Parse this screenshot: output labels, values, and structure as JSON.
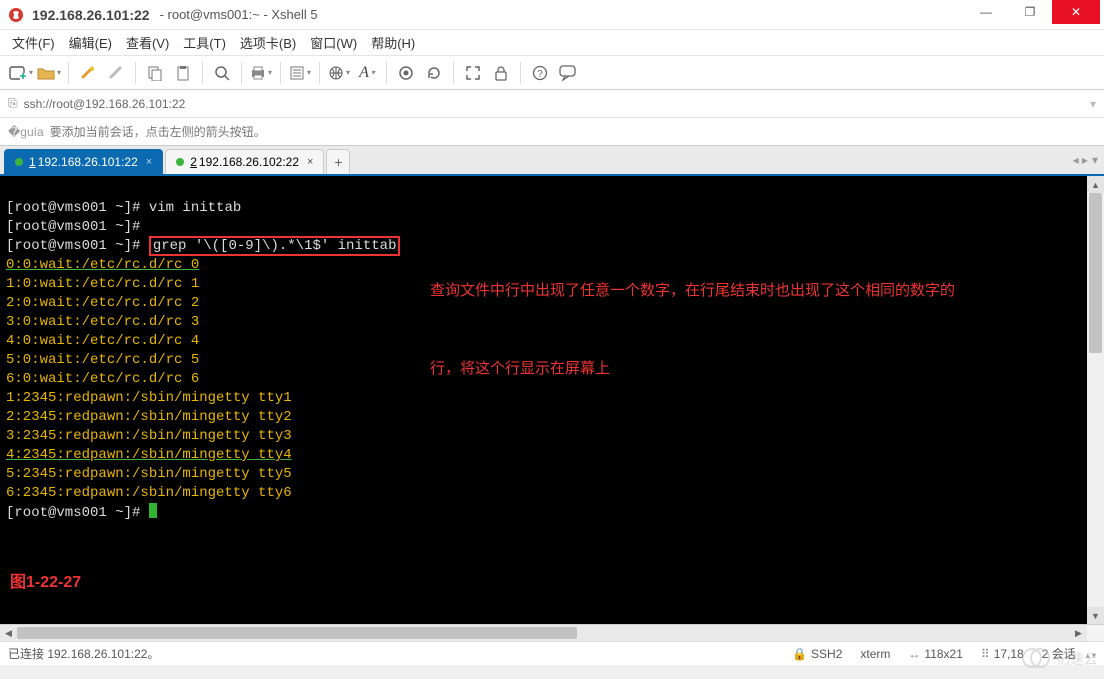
{
  "window": {
    "title_ip": "192.168.26.101:22",
    "title_rest": "root@vms001:~ - Xshell 5"
  },
  "win_controls": {
    "min": "—",
    "max": "❐",
    "close": "✕"
  },
  "menu": {
    "file": "文件(F)",
    "edit": "编辑(E)",
    "view": "查看(V)",
    "tools": "工具(T)",
    "tabs": "选项卡(B)",
    "window": "窗口(W)",
    "help": "帮助(H)"
  },
  "address": {
    "url": "ssh://root@192.168.26.101:22"
  },
  "hint": {
    "text": "要添加当前会话，点击左侧的箭头按钮。"
  },
  "tabs": {
    "t1_num": "1",
    "t1_label": "192.168.26.101:22",
    "t2_num": "2",
    "t2_label": "192.168.26.102:22",
    "add": "+"
  },
  "terminal": {
    "l1_prompt": "[root@vms001 ~]# ",
    "l1_cmd": "vim inittab",
    "l2_prompt": "[root@vms001 ~]#",
    "l3_prompt": "[root@vms001 ~]# ",
    "l3_cmd": "grep '\\([0-9]\\).*\\1$' inittab",
    "o0": "0:0:wait:/etc/rc.d/rc 0",
    "o1": "1:0:wait:/etc/rc.d/rc 1",
    "o2": "2:0:wait:/etc/rc.d/rc 2",
    "o3": "3:0:wait:/etc/rc.d/rc 3",
    "o4": "4:0:wait:/etc/rc.d/rc 4",
    "o5": "5:0:wait:/etc/rc.d/rc 5",
    "o6": "6:0:wait:/etc/rc.d/rc 6",
    "t1": "1:2345:redpawn:/sbin/mingetty tty1",
    "t2": "2:2345:redpawn:/sbin/mingetty tty2",
    "t3": "3:2345:redpawn:/sbin/mingetty tty3",
    "t4": "4:2345:redpawn:/sbin/mingetty tty4",
    "t5": "5:2345:redpawn:/sbin/mingetty tty5",
    "t6": "6:2345:redpawn:/sbin/mingetty tty6",
    "lend_prompt": "[root@vms001 ~]# ",
    "annot_l1": "查询文件中行中出现了任意一个数字，在行尾结束时也出现了这个相同的数字的",
    "annot_l2": "行，将这个行显示在屏幕上",
    "fig_label": "图1-22-27"
  },
  "status": {
    "connected": "已连接 192.168.26.101:22。",
    "proto": "SSH2",
    "term": "xterm",
    "size": "118x21",
    "pos": "17,18",
    "sessions": "2 会话"
  },
  "watermark": "亿速云"
}
